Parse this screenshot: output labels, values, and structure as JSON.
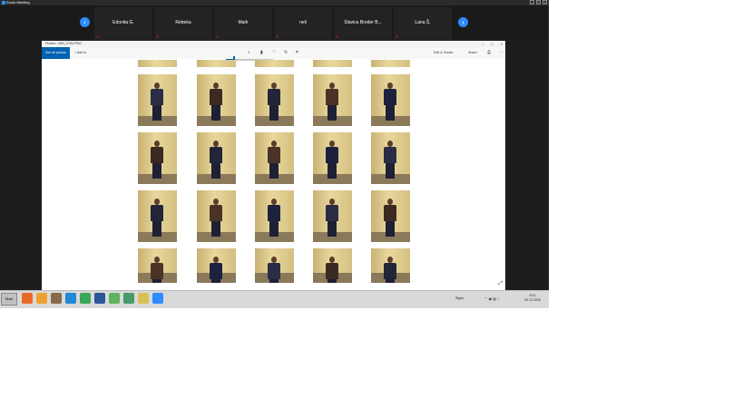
{
  "zoom": {
    "title": "Zoom Meeting",
    "participants": [
      {
        "name": "Edonita G."
      },
      {
        "name": "Rebeka"
      },
      {
        "name": "Mark"
      },
      {
        "name": "neli"
      },
      {
        "name": "Slavica Broder B..."
      },
      {
        "name": "Lana Š."
      }
    ]
  },
  "photos": {
    "title": "Photos - IMG_0753.PNG",
    "toolbar": {
      "see_all": "See all photos",
      "add_to": "+ Add to",
      "edit_create": "Edit & Create",
      "share": "Share"
    }
  },
  "taskbar": {
    "start_label": "Start",
    "language": "Šqipe",
    "time": "9:01",
    "date": "25.12.2020"
  }
}
